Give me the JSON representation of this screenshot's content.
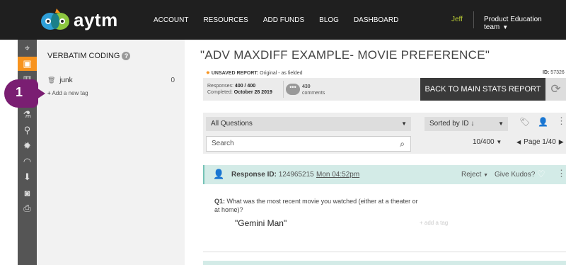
{
  "topbar": {
    "logo_text": "aytm",
    "nav": [
      "ACCOUNT",
      "RESOURCES",
      "ADD FUNDS",
      "BLOG",
      "DASHBOARD"
    ],
    "user": "Jeff",
    "team": "Product Education team"
  },
  "sidebar": {
    "title": "VERBATIM CODING",
    "tags": [
      {
        "name": "junk",
        "count": "0"
      }
    ],
    "add_tag": "Add a new tag"
  },
  "badge": {
    "number": "1"
  },
  "report": {
    "title": "\"ADV MAXDIFF EXAMPLE- MOVIE PREFERENCE\"",
    "unsaved_label": "UNSAVED REPORT:",
    "unsaved_detail": "Original - as fielded",
    "id_label": "ID:",
    "id_value": "57326",
    "responses_label": "Responses:",
    "responses_value": "400 / 400",
    "completed_label": "Completed:",
    "completed_value": "October 28 2019",
    "comments_count": "430",
    "comments_label": "comments",
    "back_button": "BACK TO MAIN STATS REPORT"
  },
  "filters": {
    "question_select": "All Questions",
    "sort_select": "Sorted by ID ↓",
    "search_placeholder": "Search",
    "page_size": "10/400",
    "page_info": "Page 1/40"
  },
  "response": {
    "id_label": "Response ID:",
    "id_value": "124965215",
    "time": "Mon 04:52pm",
    "reject": "Reject",
    "kudos": "Give Kudos?",
    "question_label": "Q1:",
    "question_text": "What was the most recent movie you watched (either at a theater or at home)?",
    "answer": "\"Gemini Man\"",
    "add_tag": "+ add a tag"
  },
  "colors": {
    "topbar": "#1f1f1f",
    "accent_orange": "#f7931e",
    "user_green": "#b7c934",
    "badge_purple": "#7a1e72",
    "response_teal": "#d3ebe7"
  }
}
